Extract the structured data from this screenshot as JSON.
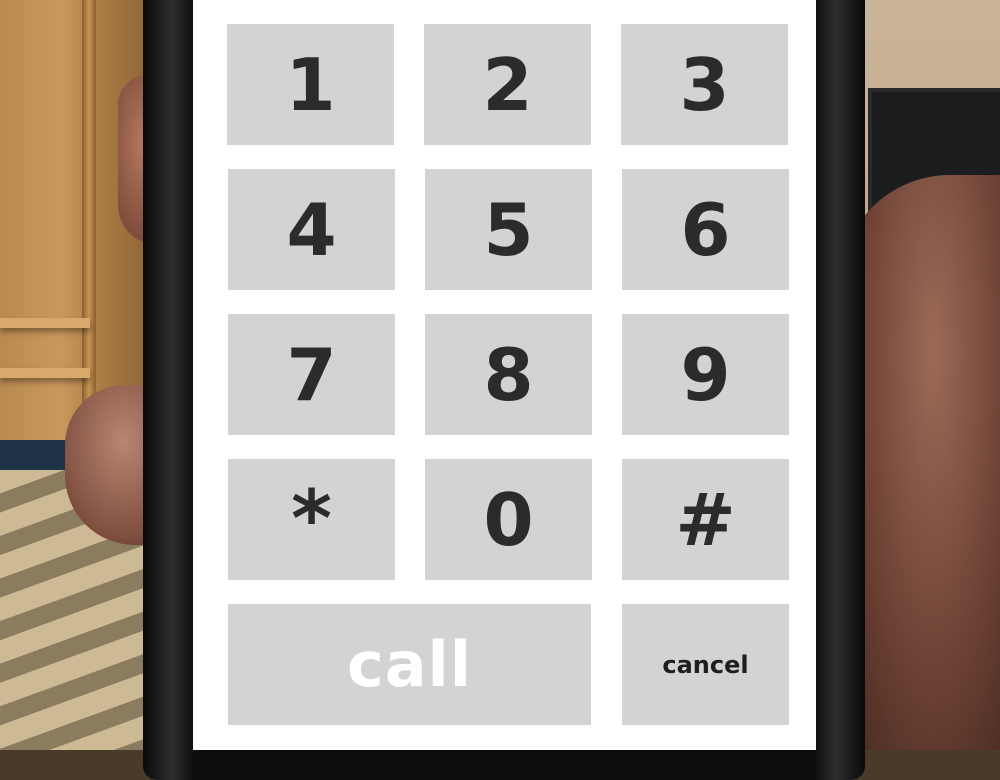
{
  "keypad": {
    "rows": [
      [
        {
          "label": "1"
        },
        {
          "label": "2"
        },
        {
          "label": "3"
        }
      ],
      [
        {
          "label": "4"
        },
        {
          "label": "5"
        },
        {
          "label": "6"
        }
      ],
      [
        {
          "label": "7"
        },
        {
          "label": "8"
        },
        {
          "label": "9"
        }
      ],
      [
        {
          "label": "*"
        },
        {
          "label": "0"
        },
        {
          "label": "#"
        }
      ]
    ],
    "call_label": "call",
    "cancel_label": "cancel"
  },
  "colors": {
    "screen_background": "#ffffff",
    "key_background": "#d3d3d3",
    "key_text": "#2b2b2b",
    "call_text": "#ffffff",
    "phone_bezel": "#111111"
  }
}
